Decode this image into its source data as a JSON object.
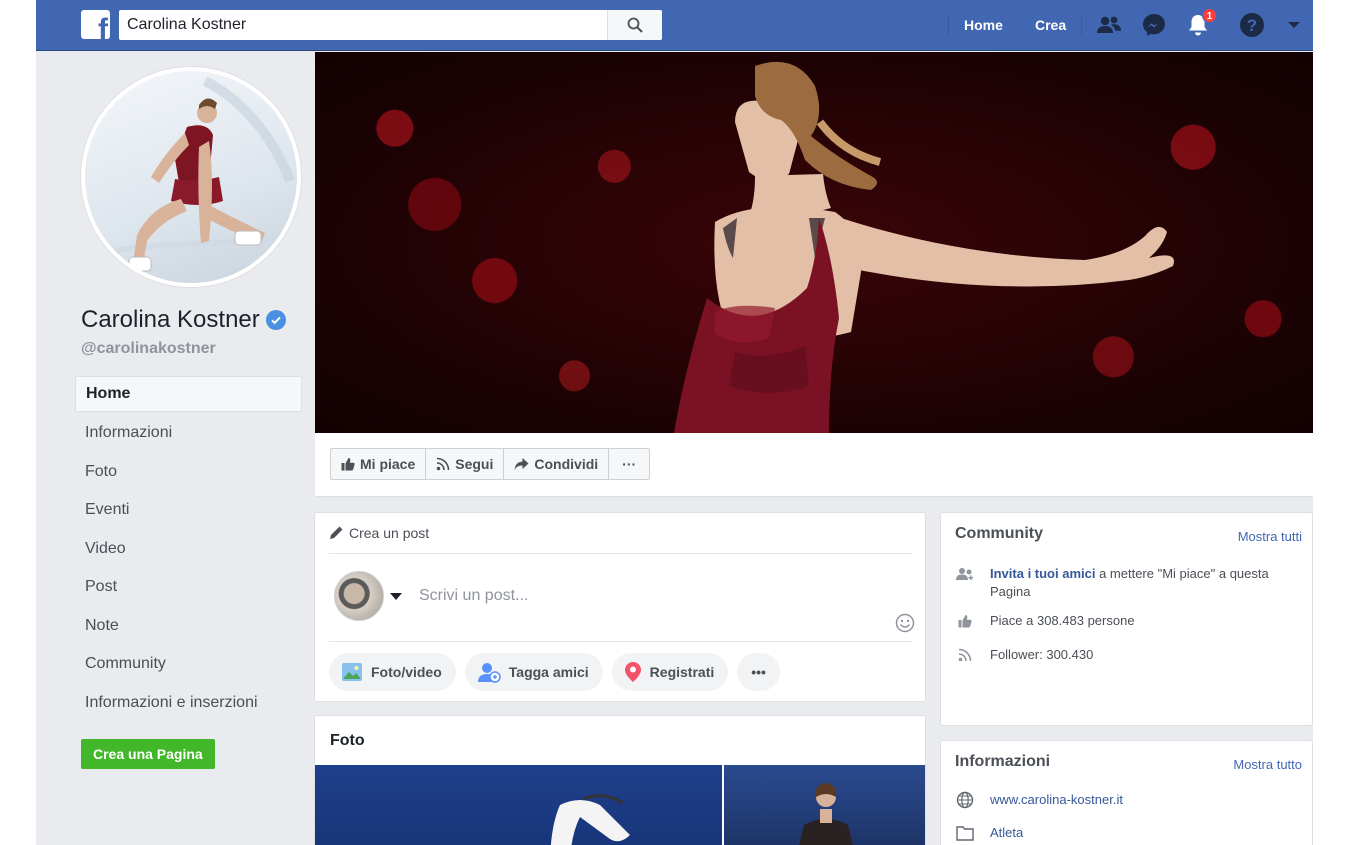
{
  "topbar": {
    "logo": "f",
    "search_value": "Carolina Kostner",
    "nav_home": "Home",
    "nav_create": "Crea",
    "notifications_count": "1",
    "icons": [
      "friends-icon",
      "messenger-icon",
      "bell-icon",
      "help-icon",
      "caret-down-icon"
    ]
  },
  "profile": {
    "name": "Carolina Kostner",
    "handle": "@carolinakostner"
  },
  "sidebar": {
    "items": [
      {
        "label": "Home",
        "active": true
      },
      {
        "label": "Informazioni"
      },
      {
        "label": "Foto"
      },
      {
        "label": "Eventi"
      },
      {
        "label": "Video"
      },
      {
        "label": "Post"
      },
      {
        "label": "Note"
      },
      {
        "label": "Community"
      },
      {
        "label": "Informazioni e inserzioni"
      }
    ],
    "create_page": "Crea una Pagina"
  },
  "actions": {
    "like": "Mi piace",
    "follow": "Segui",
    "share": "Condividi",
    "more": "···"
  },
  "composer": {
    "title": "Crea un post",
    "placeholder": "Scrivi un post...",
    "photo_video": "Foto/video",
    "tag_friends": "Tagga amici",
    "check_in": "Registrati",
    "more": "•••"
  },
  "photos": {
    "title": "Foto"
  },
  "community": {
    "title": "Community",
    "see_all": "Mostra tutti",
    "invite_link": "Invita i tuoi amici",
    "invite_rest": " a mettere \"Mi piace\" a questa Pagina",
    "likes": "Piace a 308.483 persone",
    "followers": "Follower: 300.430"
  },
  "info": {
    "title": "Informazioni",
    "see_all": "Mostra tutto",
    "website": "www.carolina-kostner.it",
    "category": "Atleta"
  },
  "colors": {
    "brand_blue": "#4267b2",
    "link_blue": "#365899",
    "create_green": "#42b72a",
    "badge_red": "#fa3e3e",
    "verified_blue": "#4a90e2"
  }
}
